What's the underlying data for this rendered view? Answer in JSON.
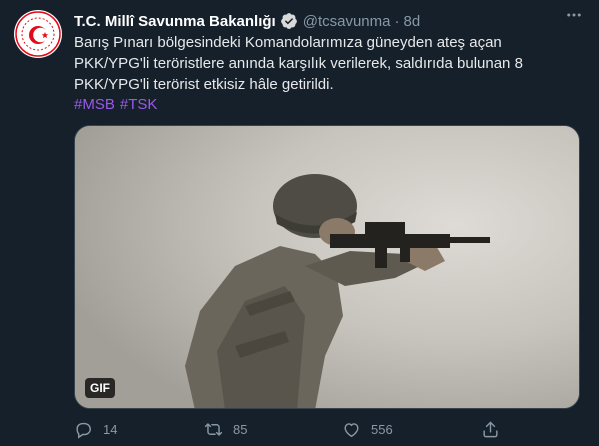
{
  "tweet": {
    "author_name": "T.C. Millî Savunma Bakanlığı",
    "handle": "@tcsavunma",
    "separator": "·",
    "time": "8d",
    "text": "Barış Pınarı bölgesindeki Komandolarımıza güneyden ateş açan PKK/YPG'li teröristlere anında karşılık verilerek, saldırıda bulunan 8 PKK/YPG'li terörist etkisiz hâle getirildi.",
    "hashtags": [
      "#MSB",
      "#TSK"
    ],
    "media": {
      "badge": "GIF"
    },
    "actions": {
      "reply": "14",
      "retweet": "85",
      "like": "556"
    }
  },
  "colors": {
    "background": "#15202b",
    "hashtag": "#9b59e8",
    "muted": "#8899a6",
    "verified": "#1d9bf0",
    "logo_red": "#e30a17"
  },
  "icons": [
    "verified-badge-icon",
    "more-icon",
    "reply-icon",
    "retweet-icon",
    "like-icon",
    "share-icon"
  ]
}
